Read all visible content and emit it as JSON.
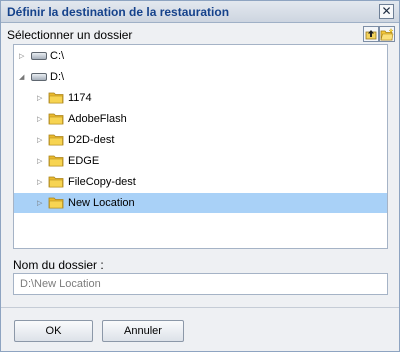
{
  "window": {
    "title": "Définir la destination de la restauration",
    "close_glyph": "✕"
  },
  "browser": {
    "label": "Sélectionner un dossier",
    "toolbar": [
      {
        "name": "up-folder-icon",
        "tooltip": ""
      },
      {
        "name": "new-folder-icon",
        "tooltip": ""
      }
    ],
    "tree": [
      {
        "label": "C:\\",
        "icon": "drive-icon",
        "expander": "collapsed",
        "selected": false
      },
      {
        "label": "D:\\",
        "icon": "drive-icon",
        "expander": "expanded",
        "selected": false
      },
      {
        "label": "1174",
        "icon": "folder-icon",
        "expander": "collapsed",
        "selected": false
      },
      {
        "label": "AdobeFlash",
        "icon": "folder-icon",
        "expander": "collapsed",
        "selected": false
      },
      {
        "label": "D2D-dest",
        "icon": "folder-icon",
        "expander": "collapsed",
        "selected": false
      },
      {
        "label": "EDGE",
        "icon": "folder-icon",
        "expander": "collapsed",
        "selected": false
      },
      {
        "label": "FileCopy-dest",
        "icon": "folder-icon",
        "expander": "collapsed",
        "selected": false
      },
      {
        "label": "New Location",
        "icon": "folder-icon",
        "expander": "collapsed",
        "selected": true
      }
    ]
  },
  "folder_name": {
    "label": "Nom du dossier :",
    "value": "D:\\New Location"
  },
  "buttons": {
    "ok": "OK",
    "cancel": "Annuler"
  },
  "colors": {
    "title": "#15428b",
    "selection": "#a9d1f7",
    "folder": "#f7d452"
  }
}
